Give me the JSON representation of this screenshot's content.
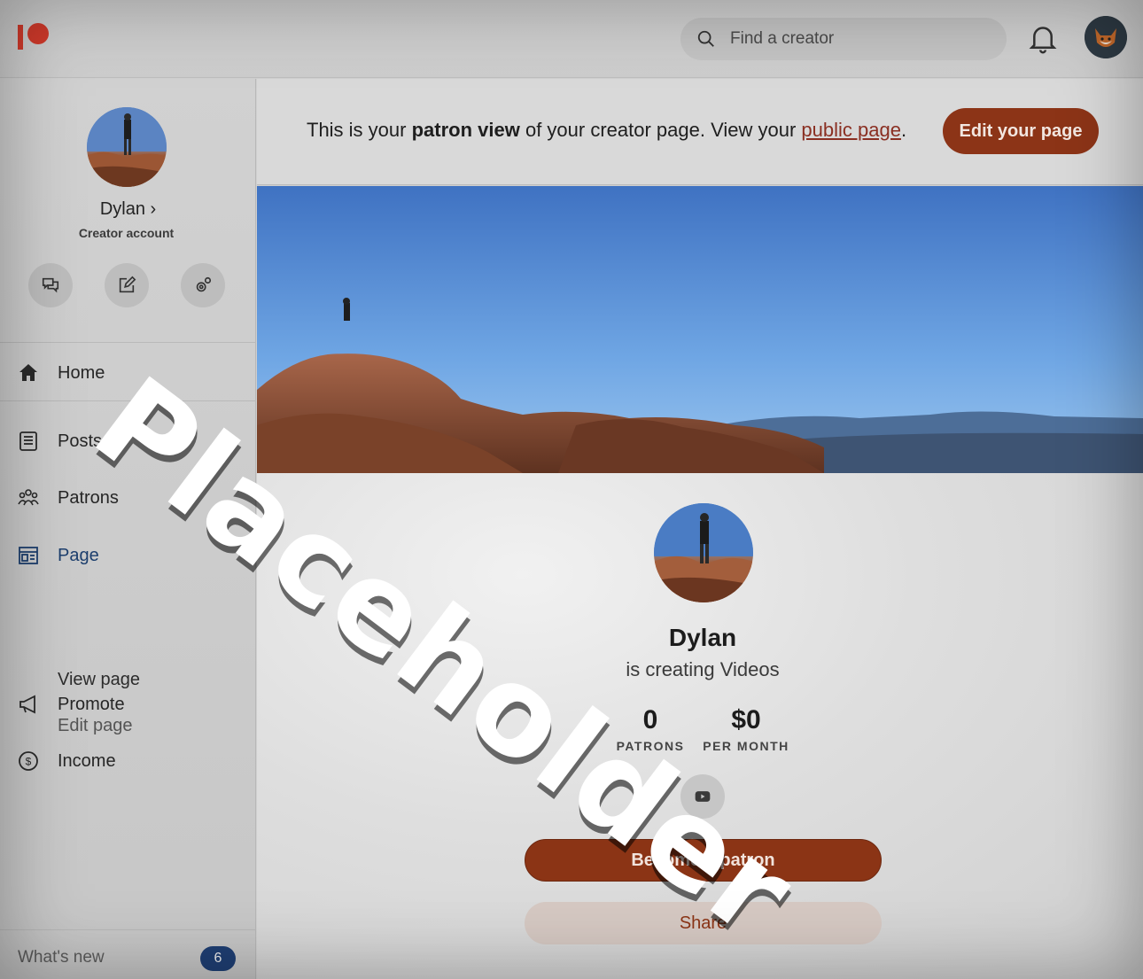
{
  "topbar": {
    "logo": "patreon-logo",
    "search_placeholder": "Find a creator",
    "brand_color": "#d23a2b"
  },
  "sidebar": {
    "profile_name": "Dylan",
    "profile_sub": "Creator account",
    "quick_actions": [
      "chat-icon",
      "edit-icon",
      "settings-icon"
    ],
    "items": [
      {
        "label": "Home",
        "icon": "home-icon"
      },
      {
        "label": "Posts",
        "icon": "posts-icon"
      },
      {
        "label": "Patrons",
        "icon": "patrons-icon"
      },
      {
        "label": "Page",
        "icon": "page-icon"
      },
      {
        "label": "Promote",
        "icon": "megaphone-icon"
      },
      {
        "label": "Income",
        "icon": "dollar-icon"
      }
    ],
    "page_sub_items": [
      "View page",
      "Edit page"
    ],
    "whats_new": "What's new",
    "whats_new_count": "6"
  },
  "banner": {
    "text_pre": "This is your ",
    "text_bold": "patron view",
    "text_mid": " of your creator page. View your ",
    "link": "public page",
    "text_post": ".",
    "edit_button": "Edit your page"
  },
  "creator": {
    "name": "Dylan",
    "tagline": "is creating Videos",
    "patrons_count": "0",
    "patrons_label": "PATRONS",
    "income": "$0",
    "income_label": "PER MONTH",
    "social": "youtube-icon",
    "become_button": "Become a patron",
    "share_button": "Share",
    "accent": "#8b3415"
  },
  "watermark": "Placeholder"
}
